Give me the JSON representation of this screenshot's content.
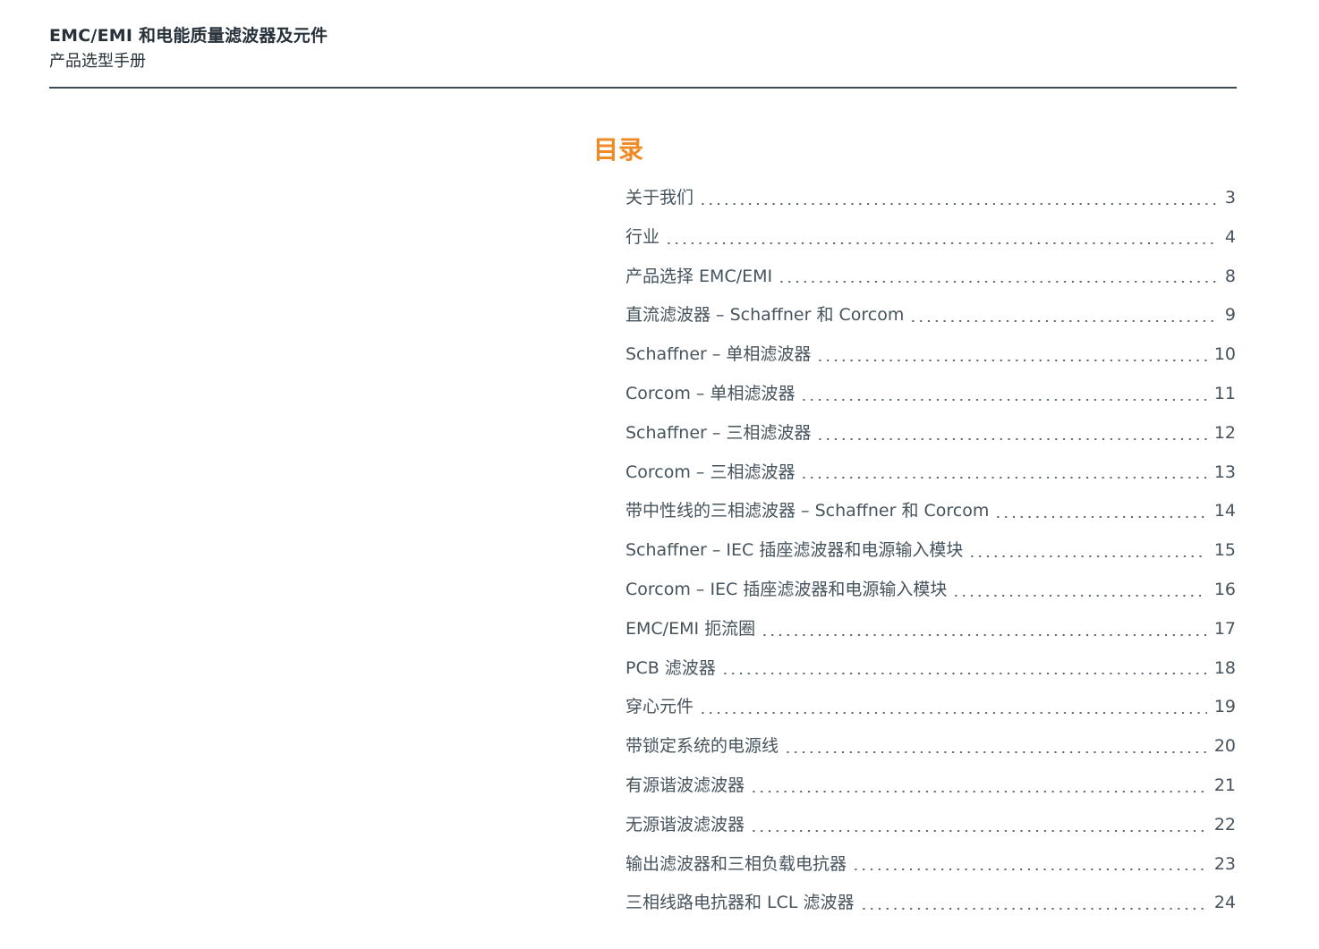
{
  "header": {
    "title": "EMC/EMI 和电能质量滤波器及元件",
    "subtitle": "产品选型手册"
  },
  "toc": {
    "heading": "目录",
    "heading_color": "#f08a24",
    "entries": [
      {
        "label": "关于我们",
        "page": "3"
      },
      {
        "label": "行业",
        "page": "4"
      },
      {
        "label": "产品选择 EMC/EMI",
        "page": "8"
      },
      {
        "label": "直流滤波器 – Schaffner 和 Corcom",
        "page": "9"
      },
      {
        "label": "Schaffner – 单相滤波器",
        "page": "10"
      },
      {
        "label": "Corcom – 单相滤波器",
        "page": "11"
      },
      {
        "label": "Schaffner – 三相滤波器",
        "page": "12"
      },
      {
        "label": "Corcom – 三相滤波器",
        "page": "13"
      },
      {
        "label": "带中性线的三相滤波器 – Schaffner 和 Corcom",
        "page": "14"
      },
      {
        "label": "Schaffner – IEC 插座滤波器和电源输入模块",
        "page": "15"
      },
      {
        "label": "Corcom – IEC 插座滤波器和电源输入模块",
        "page": "16"
      },
      {
        "label": "EMC/EMI 扼流圈",
        "page": "17"
      },
      {
        "label": "PCB 滤波器",
        "page": "18"
      },
      {
        "label": "穿心元件",
        "page": "19"
      },
      {
        "label": "带锁定系统的电源线",
        "page": "20"
      },
      {
        "label": "有源谐波滤波器",
        "page": "21"
      },
      {
        "label": "无源谐波滤波器",
        "page": "22"
      },
      {
        "label": "输出滤波器和三相负载电抗器",
        "page": "23"
      },
      {
        "label": "三相线路电抗器和 LCL 滤波器",
        "page": "24"
      }
    ]
  }
}
